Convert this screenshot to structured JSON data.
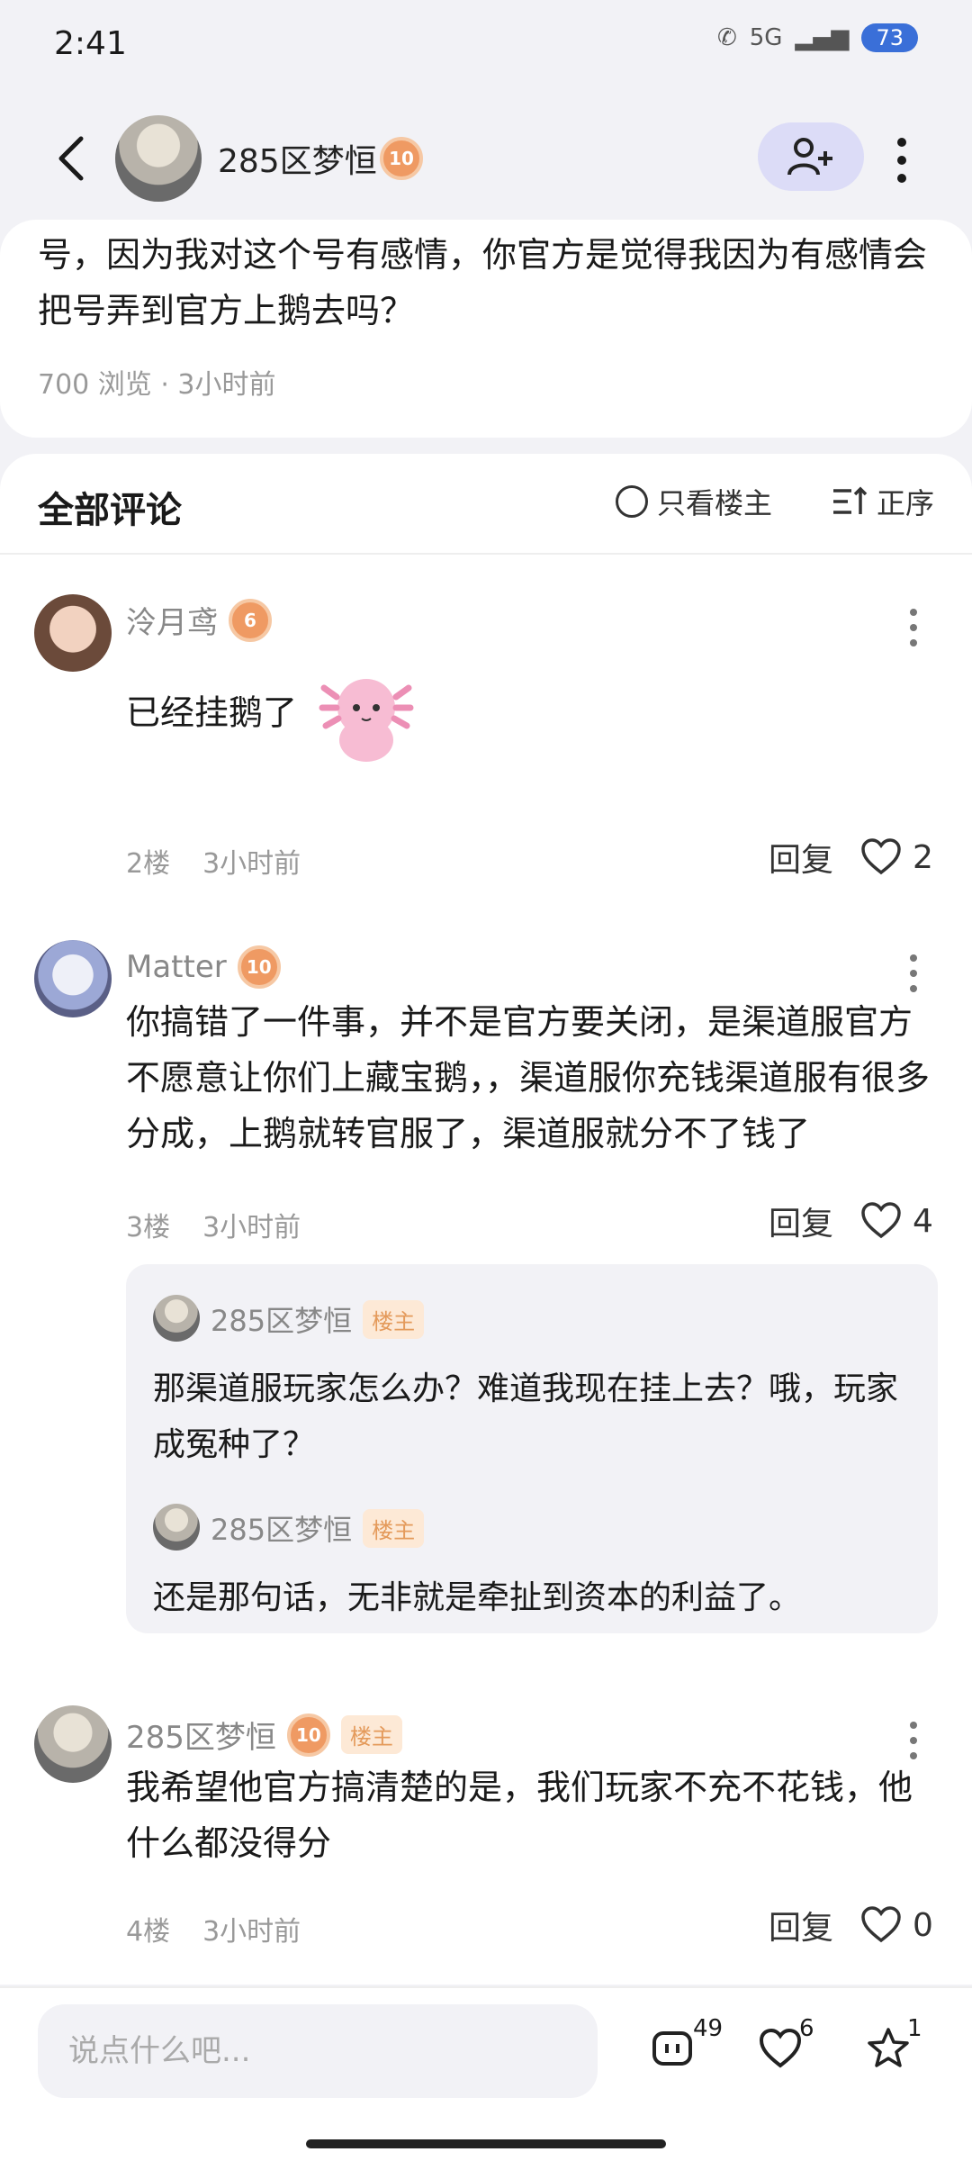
{
  "status_bar": {
    "time": "2:41",
    "network": "5G",
    "battery": "73"
  },
  "header": {
    "username": "285区梦恒",
    "level": "10"
  },
  "post": {
    "text": "号，因为我对这个号有感情，你官方是觉得我因为有感情会把号弄到官方上鹅去吗？",
    "meta": "700 浏览 · 3小时前"
  },
  "comments_section": {
    "title": "全部评论",
    "owner_only_label": "只看楼主",
    "sort_label": "正序"
  },
  "comments": [
    {
      "name": "泠月鸢",
      "level": "6",
      "text": "已经挂鹅了",
      "floor": "2楼",
      "time": "3小时前",
      "reply_label": "回复",
      "likes": "2"
    },
    {
      "name": "Matter",
      "level": "10",
      "text": "你搞错了一件事，并不是官方要关闭，是渠道服官方不愿意让你们上藏宝鹅，，渠道服你充钱渠道服有很多分成，上鹅就转官服了，渠道服就分不了钱了",
      "floor": "3楼",
      "time": "3小时前",
      "reply_label": "回复",
      "likes": "4",
      "replies": [
        {
          "name": "285区梦恒",
          "tag": "楼主",
          "text": "那渠道服玩家怎么办？难道我现在挂上去？哦，玩家成冤种了？"
        },
        {
          "name": "285区梦恒",
          "tag": "楼主",
          "text": "还是那句话，无非就是牵扯到资本的利益了。"
        }
      ]
    },
    {
      "name": "285区梦恒",
      "level": "10",
      "tag": "楼主",
      "text": "我希望他官方搞清楚的是，我们玩家不充不花钱，他什么都没得分",
      "floor": "4楼",
      "time": "3小时前",
      "reply_label": "回复",
      "likes": "0"
    }
  ],
  "bottom_bar": {
    "input_placeholder": "说点什么吧...",
    "comments_count": "49",
    "likes_count": "6",
    "favorites_count": "1"
  }
}
